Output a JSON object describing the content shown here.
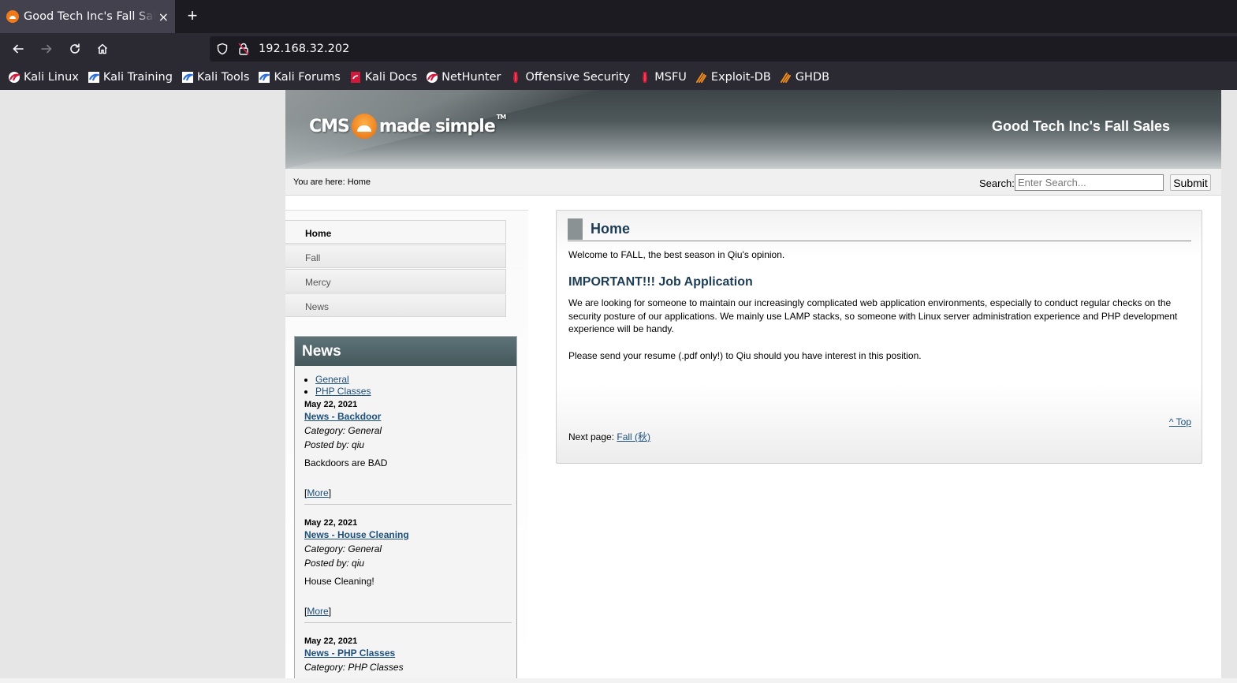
{
  "browser": {
    "tab_title": "Good Tech Inc's Fall Sales",
    "tab_close": "×",
    "new_tab": "+",
    "url": "192.168.32.202",
    "bookmarks": [
      {
        "label": "Kali Linux",
        "icon": "kali-dragon-red-icon"
      },
      {
        "label": "Kali Training",
        "icon": "kali-dragon-blue-icon"
      },
      {
        "label": "Kali Tools",
        "icon": "kali-dragon-blue-icon"
      },
      {
        "label": "Kali Forums",
        "icon": "kali-dragon-blue-icon"
      },
      {
        "label": "Kali Docs",
        "icon": "kali-docs-red-icon"
      },
      {
        "label": "NetHunter",
        "icon": "kali-dragon-red-icon"
      },
      {
        "label": "Offensive Security",
        "icon": "offsec-red-icon"
      },
      {
        "label": "MSFU",
        "icon": "offsec-red-icon"
      },
      {
        "label": "Exploit-DB",
        "icon": "exploitdb-orange-icon"
      },
      {
        "label": "GHDB",
        "icon": "exploitdb-orange-icon"
      }
    ]
  },
  "header": {
    "logo_left": "CMS",
    "logo_right": "made simple",
    "logo_tm": "TM",
    "site_title": "Good Tech Inc's Fall Sales"
  },
  "crumbbar": {
    "breadcrumb": "You are here: Home",
    "search_label": "Search:",
    "search_placeholder": "Enter Search...",
    "submit_label": "Submit"
  },
  "menu": {
    "items": [
      {
        "label": "Home",
        "active": true
      },
      {
        "label": "Fall",
        "active": false
      },
      {
        "label": "Mercy",
        "active": false
      },
      {
        "label": "News",
        "active": false
      }
    ]
  },
  "news": {
    "heading": "News",
    "categories": [
      "General",
      "PHP Classes"
    ],
    "items": [
      {
        "date": "May 22, 2021",
        "title": "News - Backdoor",
        "category": "Category: General",
        "posted": "Posted by: qiu",
        "summary": "Backdoors are BAD",
        "more_open": "[",
        "more": "More",
        "more_close": "]"
      },
      {
        "date": "May 22, 2021",
        "title": "News - House Cleaning",
        "category": "Category: General",
        "posted": "Posted by: qiu",
        "summary": "House Cleaning!",
        "more_open": "[",
        "more": "More",
        "more_close": "]"
      },
      {
        "date": "May 22, 2021",
        "title": "News - PHP Classes",
        "category": "Category: PHP Classes"
      }
    ]
  },
  "content": {
    "heading": "Home",
    "welcome": "Welcome to FALL, the best season in Qiu's opinion.",
    "subheading": "IMPORTANT!!! Job Application",
    "para1": "We are looking for someone to maintain our increasingly complicated web application environments, especially to conduct regular checks on the security posture of our applications. We mainly use LAMP stacks, so someone with Linux server administration experience and PHP development experience will be handy.",
    "para2": "Please send your resume (.pdf only!) to Qiu should you have interest in this position.",
    "top_link": "^ Top",
    "next_label": "Next page:",
    "next_link": "Fall (秋)"
  },
  "colors": {
    "link": "#1d4f7c",
    "heading": "#1d3d55",
    "browser_bg": "#2b2a33",
    "tabbar_bg": "#1c1b22"
  }
}
